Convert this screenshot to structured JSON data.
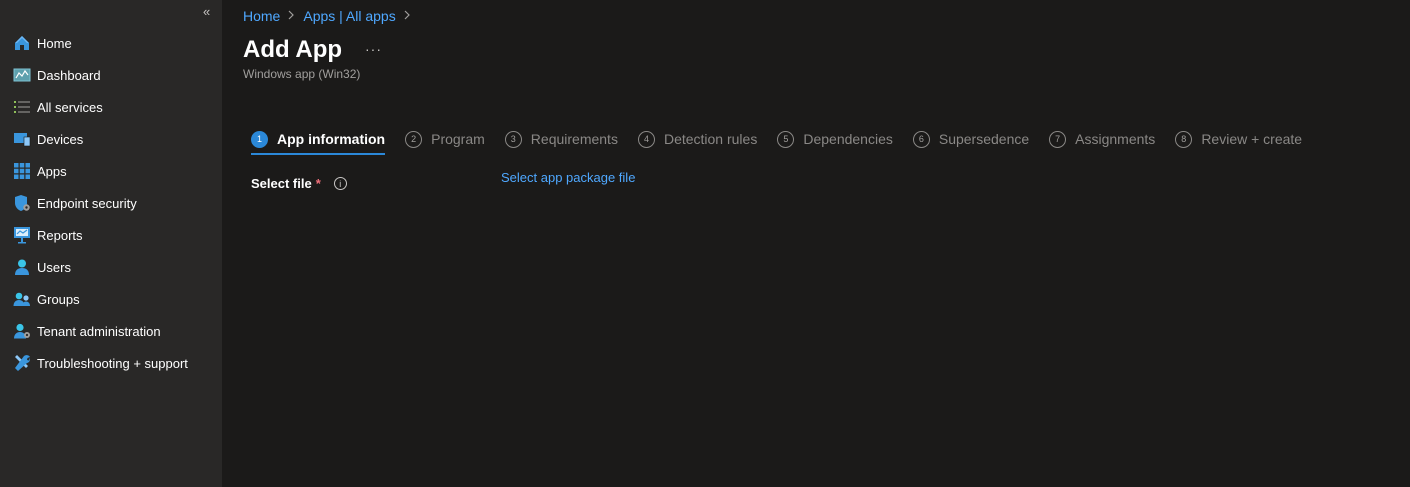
{
  "sidebar": {
    "collapse_label": "«",
    "items": [
      {
        "label": "Home",
        "icon": "home-icon"
      },
      {
        "label": "Dashboard",
        "icon": "dashboard-icon"
      },
      {
        "label": "All services",
        "icon": "list-icon"
      },
      {
        "label": "Devices",
        "icon": "devices-icon"
      },
      {
        "label": "Apps",
        "icon": "apps-grid-icon"
      },
      {
        "label": "Endpoint security",
        "icon": "shield-icon"
      },
      {
        "label": "Reports",
        "icon": "reports-icon"
      },
      {
        "label": "Users",
        "icon": "user-icon"
      },
      {
        "label": "Groups",
        "icon": "groups-icon"
      },
      {
        "label": "Tenant administration",
        "icon": "tenant-admin-icon"
      },
      {
        "label": "Troubleshooting + support",
        "icon": "wrench-icon"
      }
    ]
  },
  "breadcrumb": {
    "home": "Home",
    "apps": "Apps | All apps",
    "separator": ">"
  },
  "header": {
    "title": "Add App",
    "more": "···",
    "subtitle": "Windows app (Win32)"
  },
  "tabs": [
    {
      "num": "1",
      "label": "App information"
    },
    {
      "num": "2",
      "label": "Program"
    },
    {
      "num": "3",
      "label": "Requirements"
    },
    {
      "num": "4",
      "label": "Detection rules"
    },
    {
      "num": "5",
      "label": "Dependencies"
    },
    {
      "num": "6",
      "label": "Supersedence"
    },
    {
      "num": "7",
      "label": "Assignments"
    },
    {
      "num": "8",
      "label": "Review + create"
    }
  ],
  "form": {
    "select_file_label": "Select file",
    "required_marker": "*",
    "info_glyph": "i",
    "select_file_link": "Select app package file"
  },
  "colors": {
    "accent": "#2b88d8",
    "link": "#4fa8ff",
    "background": "#1b1a19",
    "sidebar": "#292827"
  }
}
